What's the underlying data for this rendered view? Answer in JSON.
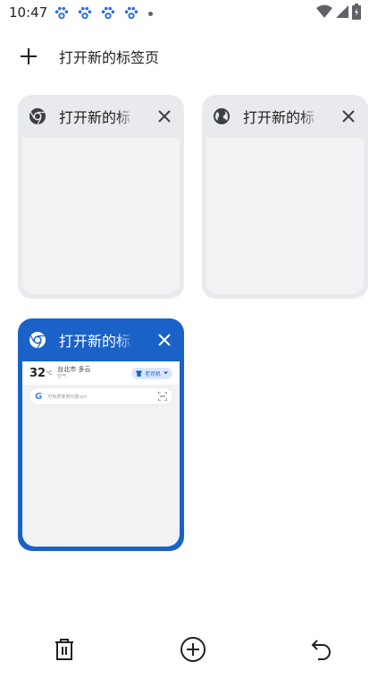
{
  "status_bar": {
    "time": "10:47",
    "notification_icons": [
      "baidu-paw-icon",
      "baidu-paw-icon",
      "baidu-paw-icon",
      "baidu-paw-icon",
      "more-dot-icon"
    ],
    "right_icons": [
      "wifi-icon",
      "cell-signal-icon",
      "battery-icon"
    ]
  },
  "new_tab": {
    "label": "打开新的标签页"
  },
  "tabs": [
    {
      "title": "打开新的标",
      "favicon": "chrome-icon",
      "active": false
    },
    {
      "title": "打开新的标",
      "favicon": "globe-icon",
      "active": false
    },
    {
      "title": "打开新的标",
      "favicon": "chrome-icon",
      "active": true,
      "thumbnail": {
        "temperature": "32",
        "degree": "°C",
        "location": "台北市",
        "weather": "多云",
        "weather_sub": "空气",
        "account_label": "老司机",
        "search_placeholder": "可免费使用内置vpn"
      }
    }
  ],
  "bottom_bar": {
    "icons": [
      "delete-all-icon",
      "add-tab-icon",
      "undo-icon"
    ]
  },
  "colors": {
    "accent": "#1a62c7",
    "card_bg": "#e8eaed",
    "card_body": "#f1f3f4"
  }
}
